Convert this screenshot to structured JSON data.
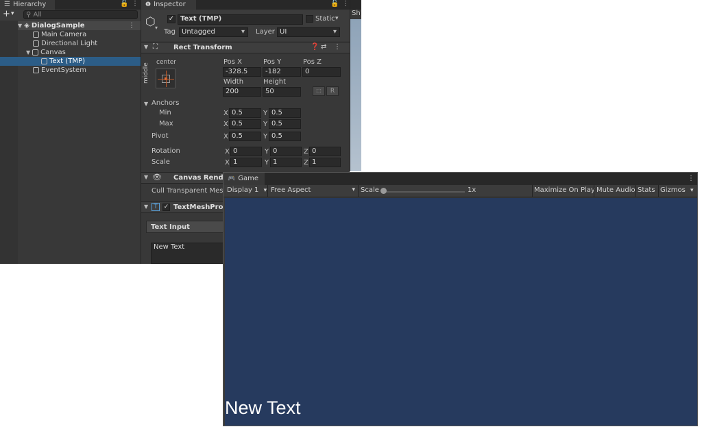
{
  "hierarchy": {
    "tab": "Hierarchy",
    "search_placeholder": "All",
    "scene": "DialogSample",
    "items": [
      "Main Camera",
      "Directional Light",
      "Canvas",
      "Text (TMP)",
      "EventSystem"
    ]
  },
  "inspector": {
    "tab": "Inspector",
    "object_name": "Text (TMP)",
    "static_label": "Static",
    "tag_label": "Tag",
    "tag_value": "Untagged",
    "layer_label": "Layer",
    "layer_value": "UI",
    "rect_transform": {
      "title": "Rect Transform",
      "anchor_h": "center",
      "anchor_v": "middle",
      "pos_x_label": "Pos X",
      "pos_y_label": "Pos Y",
      "pos_z_label": "Pos Z",
      "pos_x": "-328.5",
      "pos_y": "-182",
      "pos_z": "0",
      "width_label": "Width",
      "height_label": "Height",
      "width": "200",
      "height": "50",
      "r_label": "R",
      "anchors_label": "Anchors",
      "min_label": "Min",
      "max_label": "Max",
      "min_x": "0.5",
      "min_y": "0.5",
      "max_x": "0.5",
      "max_y": "0.5",
      "pivot_label": "Pivot",
      "pivot_x": "0.5",
      "pivot_y": "0.5",
      "rotation_label": "Rotation",
      "rot_x": "0",
      "rot_y": "0",
      "rot_z": "0",
      "scale_label": "Scale",
      "scale_x": "1",
      "scale_y": "1",
      "scale_z": "1",
      "x": "X",
      "y": "Y",
      "z": "Z"
    },
    "canvas_renderer": {
      "title": "Canvas Rende",
      "cull_label": "Cull Transparent Mesh"
    },
    "textmeshpro": {
      "title": "TextMeshPro",
      "text_input_label": "Text Input",
      "text_value": "New Text"
    }
  },
  "scene_tab_partial": "Sh",
  "game": {
    "tab": "Game",
    "display": "Display 1",
    "aspect": "Free Aspect",
    "scale_label": "Scale",
    "scale_value": "1x",
    "maximize": "Maximize On Play",
    "mute": "Mute Audio",
    "stats": "Stats",
    "gizmos": "Gizmos",
    "canvas_text": "New Text",
    "bg_color": "#263a5e"
  }
}
